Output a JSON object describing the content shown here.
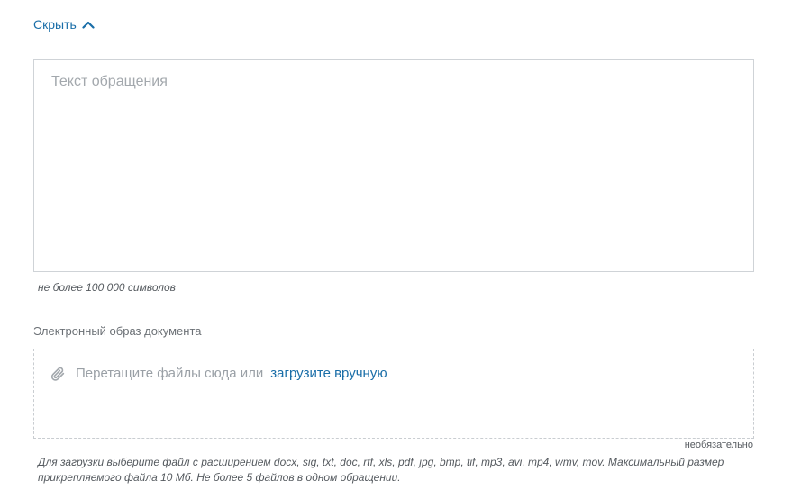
{
  "toggle": {
    "label": "Скрыть",
    "icon": "chevron-up-icon"
  },
  "message": {
    "placeholder": "Текст обращения",
    "value": "",
    "limit_hint": "не более 100 000 символов"
  },
  "attachments": {
    "label": "Электронный образ документа",
    "drop_text": "Перетащите файлы сюда или",
    "upload_link": "загрузите вручную",
    "icon": "paperclip-icon",
    "optional": "необязательно",
    "info": "Для загрузки выберите файл с расширением docx, sig, txt, doc, rtf, xls, pdf, jpg, bmp, tif, mp3, avi, mp4, wmv, mov. Максимальный размер прикрепляемого файла 10 Мб. Не более 5 файлов в одном обращении."
  },
  "colors": {
    "link": "#1a6ea8",
    "border": "#cfd3d7",
    "placeholder": "#a3a8ad"
  }
}
